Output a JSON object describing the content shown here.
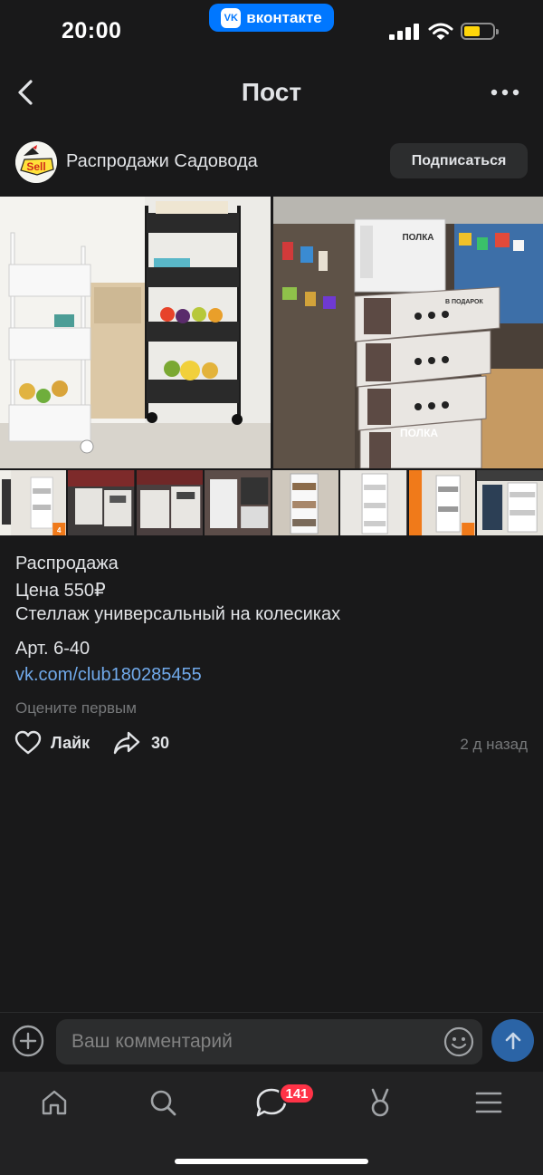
{
  "status_bar": {
    "time": "20:00",
    "app_pill": "вконтакте",
    "app_pill_logo": "VK"
  },
  "header": {
    "title": "Пост"
  },
  "author": {
    "name": "Распродажи Садовода",
    "avatar_text": "Sell",
    "subscribe_label": "Подписаться"
  },
  "photos": {
    "box_label": "ПОЛКА",
    "box_gift_label": "В ПОДАРОК",
    "thumb_count_badge": "4"
  },
  "post": {
    "lines": [
      "Распродажа",
      "Цена 550₽",
      "Стеллаж универсальный на колесиках"
    ],
    "article": "Арт. 6-40",
    "link": "vk.com/club180285455",
    "rate_hint": "Оцените первым",
    "like_label": "Лайк",
    "share_count": "30",
    "time": "2 д назад"
  },
  "comment": {
    "placeholder": "Ваш комментарий"
  },
  "tab_bar": {
    "items": [
      "home-icon",
      "search-icon",
      "messages-icon",
      "clips-icon",
      "menu-icon"
    ],
    "messages_badge": "141"
  },
  "colors": {
    "background": "#19191a",
    "accent": "#0077ff",
    "link": "#71aaeb",
    "badge": "#ff3347"
  }
}
